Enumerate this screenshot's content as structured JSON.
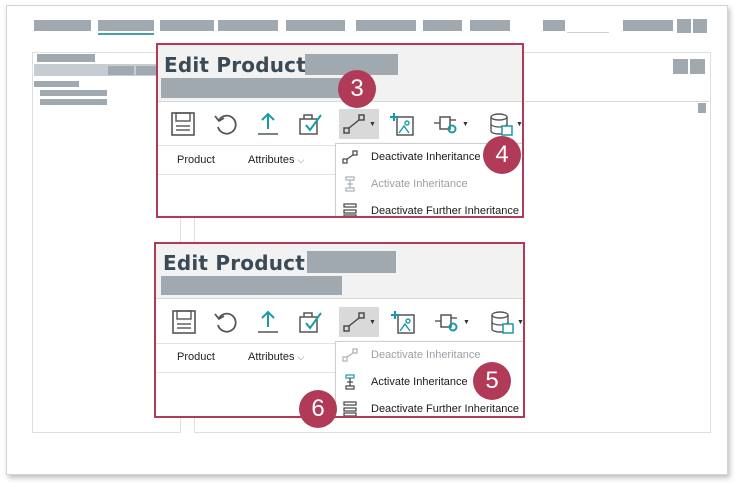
{
  "colors": {
    "accent_callout": "#b03a58",
    "title_text": "#3a4a56",
    "redacted": "#a0a9b0",
    "icon_teal": "#1a9aa8",
    "icon_gray": "#555555"
  },
  "panels": [
    {
      "title": "Edit Product:",
      "tabs": [
        {
          "label": "Product"
        },
        {
          "label": "Attributes",
          "icon": "chevron-down-icon"
        }
      ],
      "toolbar": [
        {
          "icon": "save-icon"
        },
        {
          "icon": "revert-icon"
        },
        {
          "icon": "upload-icon"
        },
        {
          "icon": "approve-icon"
        },
        {
          "icon": "inheritance-icon",
          "active": true
        },
        {
          "icon": "add-image-icon"
        },
        {
          "icon": "hierarchy-settings-icon"
        },
        {
          "icon": "database-icon"
        }
      ],
      "menu": [
        {
          "label": "Deactivate Inheritance",
          "icon": "deactivate-inheritance-icon",
          "enabled": true
        },
        {
          "label": "Activate Inheritance",
          "icon": "activate-inheritance-icon",
          "enabled": false
        },
        {
          "label": "Deactivate Further Inheritance",
          "icon": "deactivate-further-inheritance-icon",
          "enabled": true
        }
      ],
      "badges": [
        "3",
        "4"
      ]
    },
    {
      "title": "Edit Product:",
      "tabs": [
        {
          "label": "Product"
        },
        {
          "label": "Attributes",
          "icon": "chevron-down-icon"
        }
      ],
      "toolbar": [
        {
          "icon": "save-icon"
        },
        {
          "icon": "revert-icon"
        },
        {
          "icon": "upload-icon"
        },
        {
          "icon": "approve-icon"
        },
        {
          "icon": "inheritance-icon",
          "active": true
        },
        {
          "icon": "add-image-icon"
        },
        {
          "icon": "hierarchy-settings-icon"
        },
        {
          "icon": "database-icon"
        }
      ],
      "menu": [
        {
          "label": "Deactivate Inheritance",
          "icon": "deactivate-inheritance-icon",
          "enabled": false
        },
        {
          "label": "Activate Inheritance",
          "icon": "activate-inheritance-icon",
          "enabled": true
        },
        {
          "label": "Deactivate Further Inheritance",
          "icon": "deactivate-further-inheritance-icon",
          "enabled": true
        }
      ],
      "badges": [
        "5",
        "6"
      ]
    }
  ]
}
